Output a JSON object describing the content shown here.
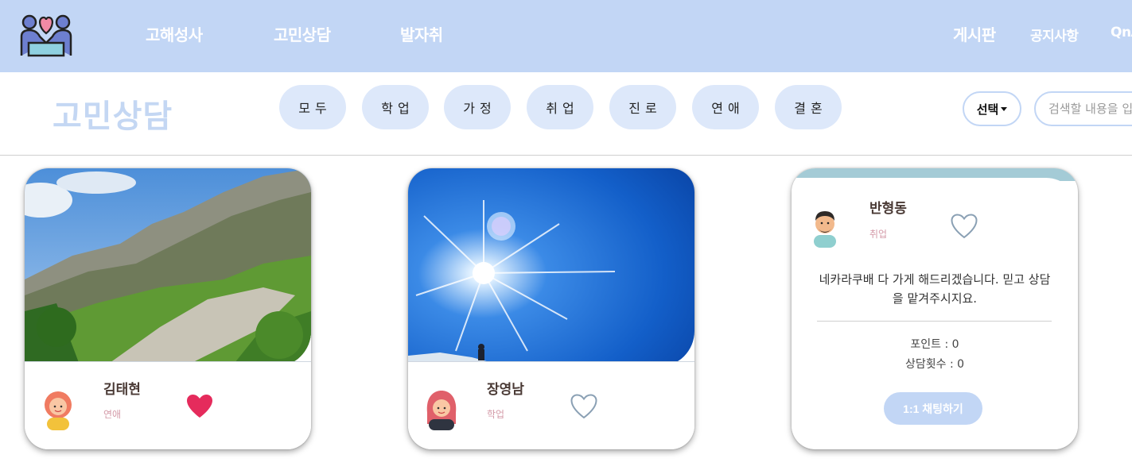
{
  "nav": {
    "logo": "couple-heart-logo",
    "links": [
      "고해성사",
      "고민상담",
      "발자취"
    ],
    "right_links": [
      "게시판",
      "공지사항",
      "QnA"
    ]
  },
  "subheader": {
    "title": "고민상담",
    "categories": [
      "모두",
      "학업",
      "가정",
      "취업",
      "진로",
      "연애",
      "결혼"
    ],
    "select_label": "선택",
    "search_placeholder": "검색할 내용을 입력하세요"
  },
  "cards": [
    {
      "name": "김태현",
      "category": "연애",
      "liked": true,
      "image": "mountain-landscape"
    },
    {
      "name": "장영남",
      "category": "학업",
      "liked": false,
      "image": "sun-sky"
    },
    {
      "name": "반형동",
      "category": "취업",
      "liked": false,
      "intro": "네카라쿠배 다 가게 해드리겠습니다. 믿고 상담을 맡겨주시지요.",
      "points": "포인트 : 0",
      "count": "상담횟수 : 0",
      "chat_label": "1:1 채팅하기"
    }
  ],
  "colors": {
    "nav_bg": "#c2d6f5",
    "pill_bg": "#dde8fa",
    "heart_filled": "#e52b5c",
    "heart_outline": "#8aa0b4"
  }
}
